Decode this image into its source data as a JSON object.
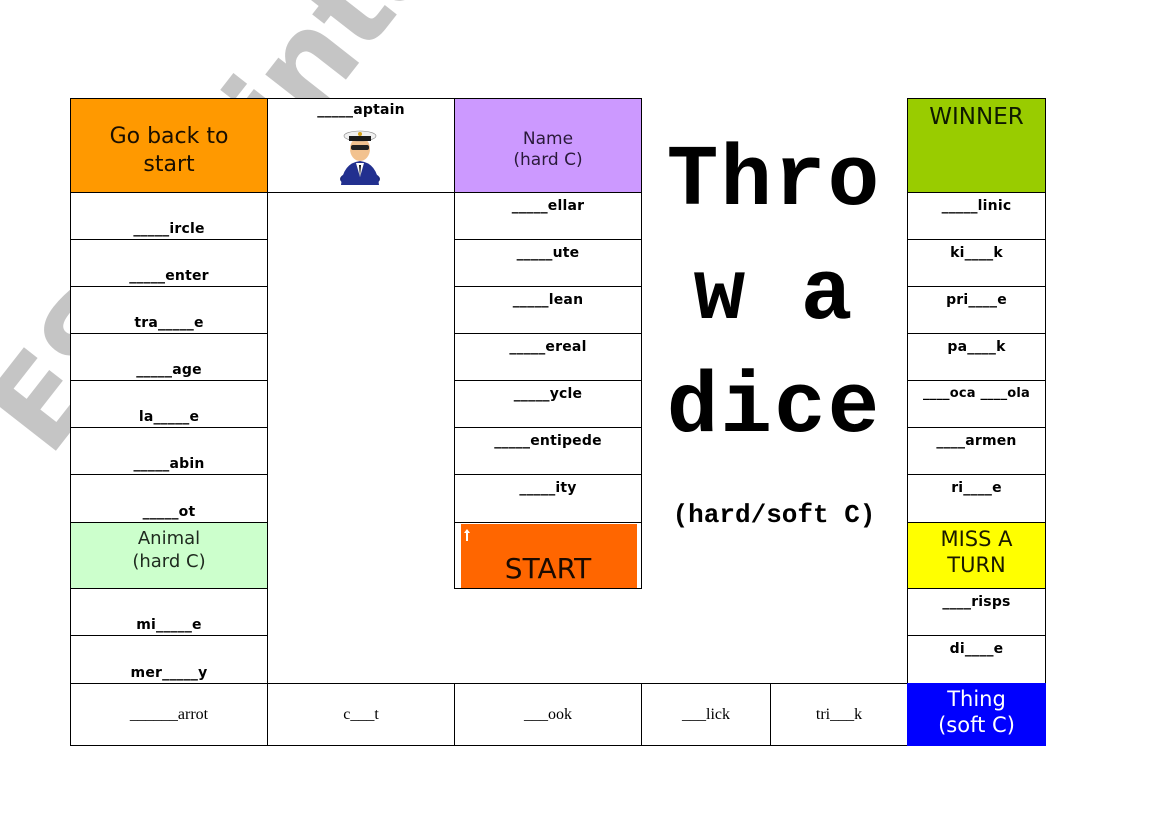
{
  "board": {
    "title_lines": [
      "Thro",
      "w a",
      "dice"
    ],
    "subtitle": "(hard/soft C)",
    "colors": {
      "go_back": "#FF9900",
      "name": "#CC99FF",
      "winner": "#99CC00",
      "animal": "#CCFFCC",
      "start": "#FF6600",
      "miss_turn": "#FFFF00",
      "thing": "#0000FF"
    },
    "special": {
      "go_back": "Go back to\nstart",
      "name": "Name\n(hard C)",
      "winner": "WINNER",
      "animal": "Animal\n(hard C)",
      "start": "START",
      "miss_turn": "MISS A\nTURN",
      "thing": "Thing\n(soft C)"
    },
    "captain": {
      "word": "_____aptain",
      "icon": "captain-icon"
    },
    "left_column": [
      "_____ircle",
      "_____enter",
      "tra_____e",
      "_____age",
      "la_____e",
      "_____abin",
      "_____ot"
    ],
    "left_column_lower": [
      "mi_____e",
      "mer_____y"
    ],
    "middle_column": [
      "_____ellar",
      "_____ute",
      "_____lean",
      "_____ereal",
      "_____ycle",
      "_____entipede",
      "_____ity"
    ],
    "right_column": [
      "_____linic",
      "ki____k",
      "pri____e",
      "pa____k",
      "____oca ____ola",
      "____armen",
      "ri____e"
    ],
    "right_column_lower": [
      "____risps",
      "di____e"
    ],
    "bottom_row": [
      "______arrot",
      "c___t",
      "___ook",
      "___lick",
      "tri___k"
    ],
    "watermark": "ESLprintables.com"
  }
}
